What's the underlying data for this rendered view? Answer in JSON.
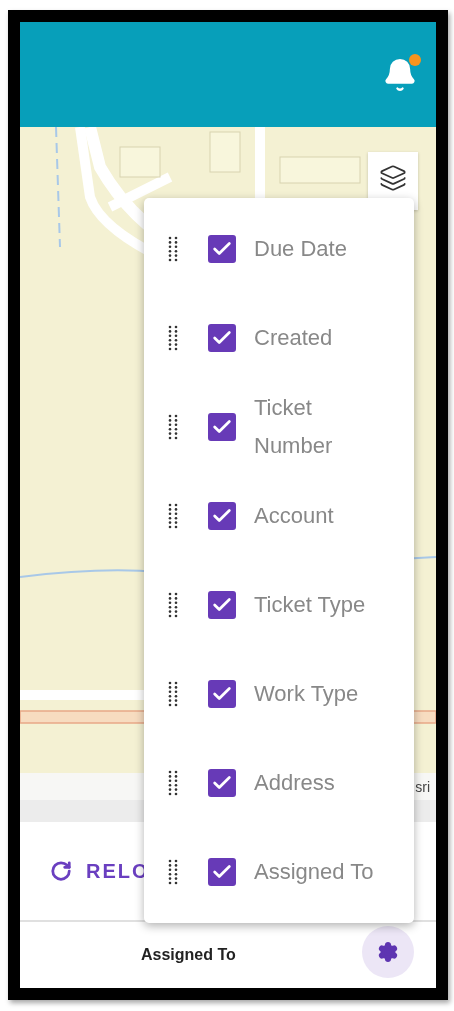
{
  "header": {
    "notifications": {
      "unread": true
    }
  },
  "map": {
    "kind": "picture",
    "attribution": "sri"
  },
  "toolbar": {
    "reload_button": "RELO"
  },
  "table": {
    "columns": [
      {
        "label": "Assigned To"
      }
    ]
  },
  "column_menu": {
    "items": [
      {
        "label": "Due Date",
        "checked": true
      },
      {
        "label": "Created",
        "checked": true
      },
      {
        "label": "Ticket Number",
        "checked": true
      },
      {
        "label": "Account",
        "checked": true
      },
      {
        "label": "Ticket Type",
        "checked": true
      },
      {
        "label": "Work Type",
        "checked": true
      },
      {
        "label": "Address",
        "checked": true
      },
      {
        "label": "Assigned To",
        "checked": true
      }
    ]
  }
}
